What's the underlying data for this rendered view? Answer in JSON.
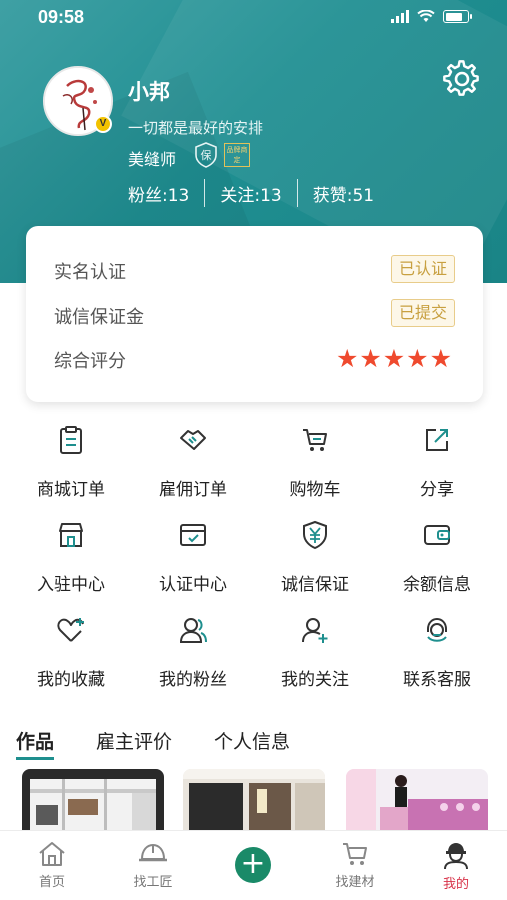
{
  "status_bar": {
    "time": "09:58",
    "battery_level": 0.8
  },
  "profile": {
    "name": "小邦",
    "motto": "一切都是最好的安排",
    "role": "美缝师",
    "shield_badge": "保",
    "brand_badge": "品牌商定",
    "verified_badge": "V",
    "stats": {
      "fans": "粉丝:13",
      "following": "关注:13",
      "likes": "获赞:51"
    }
  },
  "card": {
    "real_name": {
      "label": "实名认证",
      "status": "已认证"
    },
    "deposit": {
      "label": "诚信保证金",
      "status": "已提交"
    },
    "rating": {
      "label": "综合评分",
      "stars": "★★★★★",
      "value": 5
    }
  },
  "grid": [
    {
      "label": "商城订单",
      "icon": "clipboard-icon"
    },
    {
      "label": "雇佣订单",
      "icon": "handshake-icon"
    },
    {
      "label": "购物车",
      "icon": "cart-icon"
    },
    {
      "label": "分享",
      "icon": "share-icon"
    },
    {
      "label": "入驻中心",
      "icon": "store-icon"
    },
    {
      "label": "认证中心",
      "icon": "certificate-icon"
    },
    {
      "label": "诚信保证",
      "icon": "yuan-shield-icon"
    },
    {
      "label": "余额信息",
      "icon": "wallet-icon"
    },
    {
      "label": "我的收藏",
      "icon": "heart-icon"
    },
    {
      "label": "我的粉丝",
      "icon": "fans-icon"
    },
    {
      "label": "我的关注",
      "icon": "follow-icon"
    },
    {
      "label": "联系客服",
      "icon": "headset-icon"
    }
  ],
  "tabs": [
    {
      "label": "作品",
      "active": true
    },
    {
      "label": "雇主评价",
      "active": false
    },
    {
      "label": "个人信息",
      "active": false
    }
  ],
  "bottom_nav": [
    {
      "label": "首页",
      "icon": "home-icon",
      "active": false
    },
    {
      "label": "找工匠",
      "icon": "helmet-icon",
      "active": false
    },
    {
      "label": "+",
      "icon": "plus-icon",
      "active": false
    },
    {
      "label": "找建材",
      "icon": "cart-icon",
      "active": false
    },
    {
      "label": "我的",
      "icon": "worker-icon",
      "active": true
    }
  ],
  "colors": {
    "primary": "#1e8f8e",
    "star": "#ef4a2e",
    "active_nav": "#d8344a",
    "tag_border": "#e8cc8a",
    "fab": "#1a8a68"
  }
}
